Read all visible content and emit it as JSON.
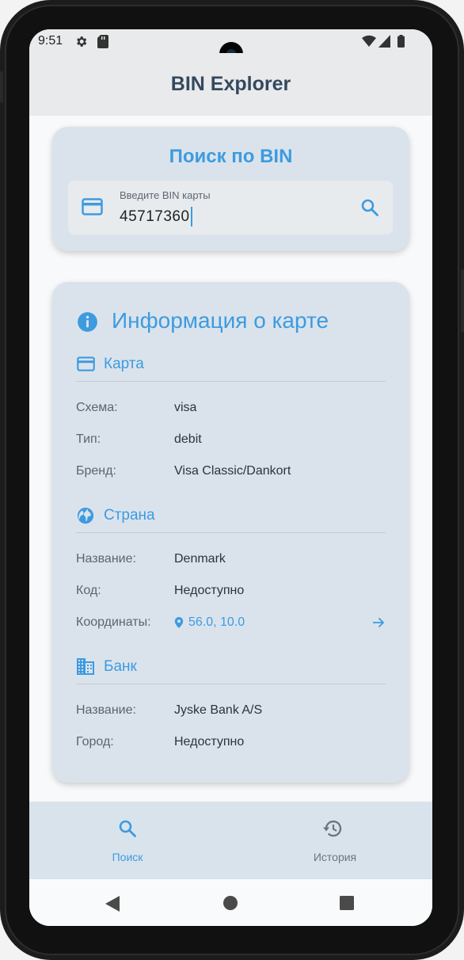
{
  "status_bar": {
    "time": "9:51",
    "icons": [
      "gear-icon",
      "sd-card-icon",
      "wifi-icon",
      "signal-icon",
      "battery-icon"
    ]
  },
  "app": {
    "title": "BIN Explorer"
  },
  "search": {
    "title": "Поиск по BIN",
    "field_label": "Введите BIN карты",
    "value": "45717360",
    "icons": {
      "leading": "credit-card-icon",
      "trailing": "search-icon"
    }
  },
  "info": {
    "title": "Информация о карте",
    "card": {
      "heading": "Карта",
      "rows": [
        {
          "label": "Схема:",
          "value": "visa"
        },
        {
          "label": "Тип:",
          "value": "debit"
        },
        {
          "label": "Бренд:",
          "value": "Visa Classic/Dankort"
        }
      ]
    },
    "country": {
      "heading": "Страна",
      "rows": [
        {
          "label": "Название:",
          "value": "Denmark"
        },
        {
          "label": "Код:",
          "value": "Недоступно"
        }
      ],
      "coords": {
        "label": "Координаты:",
        "value": "56.0, 10.0"
      }
    },
    "bank": {
      "heading": "Банк",
      "rows": [
        {
          "label": "Название:",
          "value": "Jyske Bank A/S"
        },
        {
          "label": "Город:",
          "value": "Недоступно"
        }
      ]
    }
  },
  "nav": {
    "items": [
      {
        "label": "Поиск",
        "icon": "search-icon",
        "active": true
      },
      {
        "label": "История",
        "icon": "history-icon",
        "active": false
      }
    ]
  },
  "colors": {
    "accent": "#3d9be0",
    "card_bg": "#dae3ec",
    "title": "#34495e",
    "inactive": "#6b7580"
  }
}
